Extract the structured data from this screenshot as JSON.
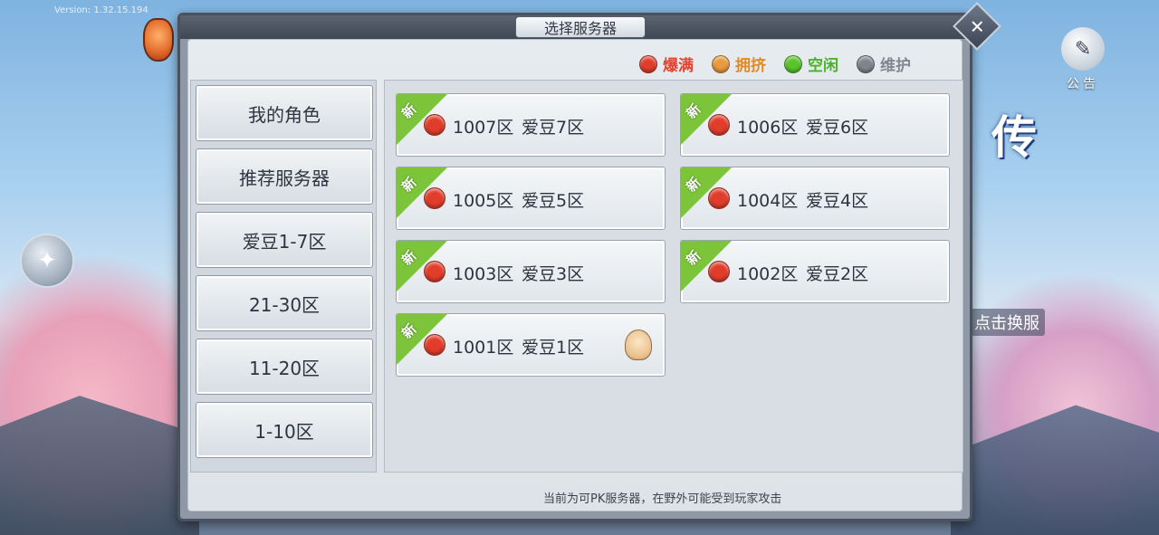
{
  "app": {
    "version_text": "Version:    1.32.15.194"
  },
  "modal": {
    "title": "选择服务器",
    "close_label": "✕"
  },
  "legend": [
    {
      "label": "爆满",
      "color": "#e23c2a",
      "text_color": "#e2452f"
    },
    {
      "label": "拥挤",
      "color": "#e99a3c",
      "text_color": "#e48a25"
    },
    {
      "label": "空闲",
      "color": "#58c52a",
      "text_color": "#49b32a"
    },
    {
      "label": "维护",
      "color": "#7f858c",
      "text_color": "#808690"
    }
  ],
  "side_nav": [
    {
      "label": "我的角色"
    },
    {
      "label": "推荐服务器"
    },
    {
      "label": "爱豆1-7区"
    },
    {
      "label": "21-30区"
    },
    {
      "label": "11-20区"
    },
    {
      "label": "1-10区"
    }
  ],
  "servers": [
    {
      "id": "1007区",
      "name": "爱豆7区",
      "tag": "新",
      "status_color": "#e23c2a"
    },
    {
      "id": "1006区",
      "name": "爱豆6区",
      "tag": "新",
      "status_color": "#e23c2a"
    },
    {
      "id": "1005区",
      "name": "爱豆5区",
      "tag": "新",
      "status_color": "#e23c2a"
    },
    {
      "id": "1004区",
      "name": "爱豆4区",
      "tag": "新",
      "status_color": "#e23c2a"
    },
    {
      "id": "1003区",
      "name": "爱豆3区",
      "tag": "新",
      "status_color": "#e23c2a"
    },
    {
      "id": "1002区",
      "name": "爱豆2区",
      "tag": "新",
      "status_color": "#e23c2a"
    },
    {
      "id": "1001区",
      "name": "爱豆1区",
      "tag": "新",
      "status_color": "#e23c2a",
      "has_character": true
    }
  ],
  "footer_note": "当前为可PK服务器，在野外可能受到玩家攻击",
  "background": {
    "notice_label": "公告",
    "title_char": "传",
    "switch_label": "点击换服"
  }
}
